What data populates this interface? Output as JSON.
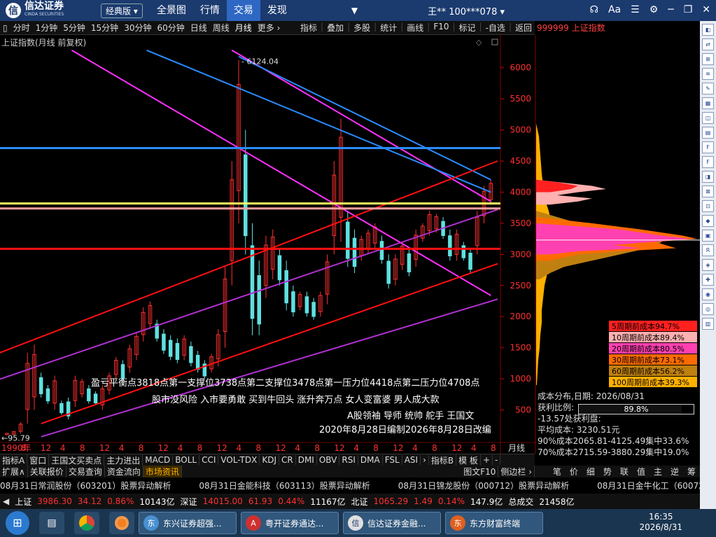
{
  "app": {
    "logo_cn": "信达证券",
    "logo_en": "CINDA SECURITIES",
    "edition": "经典版 ▾"
  },
  "nav": [
    "全景图",
    "行情",
    "交易",
    "发现"
  ],
  "nav_active": "交易",
  "user": "王**  100***078 ▾",
  "top_icons": [
    "headset-icon",
    "font-size-icon",
    "menu-icon",
    "gear-icon",
    "minimize-icon",
    "restore-icon",
    "close-icon"
  ],
  "periods": [
    "分时",
    "1分钟",
    "5分钟",
    "15分钟",
    "30分钟",
    "60分钟",
    "日线",
    "周线",
    "月线",
    "更多 ›"
  ],
  "period_selected": "月线",
  "tools": [
    "指标",
    "叠加",
    "多股",
    "统计",
    "画线",
    "F10",
    "标记",
    "-自选",
    "返回"
  ],
  "index_code": "999999 上证指数",
  "chart": {
    "title": "上证指数(月线 前复权)",
    "high_label": "6124.04",
    "low_label": "95.79",
    "y_ticks": [
      500,
      1000,
      1500,
      2000,
      2500,
      3000,
      3500,
      4000,
      4500,
      5000,
      5500,
      6000
    ],
    "x_labels": [
      "1990年",
      "8",
      "12",
      "4",
      "8",
      "12",
      "4",
      "8",
      "12",
      "4",
      "8",
      "12",
      "4",
      "8",
      "12",
      "4",
      "8",
      "12",
      "4",
      "8",
      "12",
      "4",
      "8",
      "12",
      "4",
      "8"
    ],
    "x_unit": "月线",
    "annotations": [
      "盈亏平衡点3818点第一支撑位3738点第二支撑位3478点第一压力位4418点第二压力位4708点",
      "股市没风险 入市要勇敢 买到牛回头 涨升奔万点 女人变富婆 男人成大款",
      "A股领袖 导师 统帅 舵手 王国文",
      "2020年8月28日编制2026年8月28日改编"
    ],
    "colors": {
      "up": "#ff3030",
      "down": "#60e0e0",
      "pink": "#ff30ff",
      "blue": "#2a8cff",
      "red": "#ff1010",
      "purple": "#b030d0",
      "yellow": "#ffff60",
      "salmon": "#ffa0a0"
    }
  },
  "chart_data": {
    "type": "candlestick",
    "title": "上证指数(月线 前复权)",
    "series": [
      {
        "name": "上证指数",
        "points": [
          [
            0,
            96,
            130
          ],
          [
            2,
            100,
            160
          ],
          [
            4,
            120,
            300
          ],
          [
            6,
            280,
            1420
          ],
          [
            8,
            500,
            1550
          ],
          [
            10,
            700,
            1100
          ],
          [
            12,
            600,
            900
          ],
          [
            14,
            500,
            1050
          ],
          [
            16,
            420,
            650
          ],
          [
            18,
            350,
            700
          ],
          [
            20,
            550,
            1050
          ],
          [
            22,
            700,
            1000
          ],
          [
            24,
            600,
            900
          ],
          [
            26,
            580,
            800
          ],
          [
            28,
            500,
            900
          ],
          [
            30,
            750,
            1100
          ],
          [
            32,
            1000,
            1350
          ],
          [
            34,
            950,
            1300
          ],
          [
            36,
            1100,
            1550
          ],
          [
            38,
            1300,
            1750
          ],
          [
            40,
            1600,
            2150
          ],
          [
            42,
            1800,
            2245
          ],
          [
            44,
            1600,
            1950
          ],
          [
            46,
            1400,
            1800
          ],
          [
            48,
            1300,
            1700
          ],
          [
            50,
            1250,
            1650
          ],
          [
            52,
            1300,
            1700
          ],
          [
            54,
            1200,
            1600
          ],
          [
            56,
            1100,
            1450
          ],
          [
            58,
            1000,
            1300
          ],
          [
            60,
            1100,
            1400
          ],
          [
            62,
            1200,
            1800
          ],
          [
            64,
            1500,
            2800
          ],
          [
            66,
            2500,
            4500
          ],
          [
            68,
            3500,
            6124
          ],
          [
            70,
            3000,
            5000
          ],
          [
            72,
            1700,
            3500
          ],
          [
            74,
            1700,
            2900
          ],
          [
            76,
            2300,
            3300
          ],
          [
            78,
            2600,
            3400
          ],
          [
            80,
            2500,
            3100
          ],
          [
            82,
            2100,
            2900
          ],
          [
            84,
            2000,
            2500
          ],
          [
            86,
            2100,
            2400
          ],
          [
            88,
            2000,
            2400
          ],
          [
            90,
            1950,
            2300
          ],
          [
            92,
            2000,
            2400
          ],
          [
            94,
            2200,
            3000
          ],
          [
            96,
            3000,
            4500
          ],
          [
            98,
            3200,
            5178
          ],
          [
            100,
            2800,
            3700
          ],
          [
            102,
            2700,
            3400
          ],
          [
            104,
            2900,
            3300
          ],
          [
            106,
            3000,
            3400
          ],
          [
            108,
            3100,
            3500
          ],
          [
            110,
            2850,
            3300
          ],
          [
            112,
            2450,
            3000
          ],
          [
            114,
            2500,
            3000
          ],
          [
            116,
            2750,
            3200
          ],
          [
            118,
            2650,
            3100
          ],
          [
            120,
            2800,
            3400
          ],
          [
            122,
            3200,
            3500
          ],
          [
            124,
            3300,
            3700
          ],
          [
            126,
            3350,
            3650
          ],
          [
            128,
            3250,
            3600
          ],
          [
            130,
            2900,
            3400
          ],
          [
            132,
            2900,
            3400
          ],
          [
            134,
            2900,
            3200
          ],
          [
            136,
            2700,
            3100
          ],
          [
            138,
            3000,
            3700
          ],
          [
            140,
            3500,
            4100
          ],
          [
            142,
            3800,
            4200
          ]
        ]
      }
    ],
    "axes": {
      "y_range": [
        0,
        6300
      ],
      "x_start": "1990",
      "x_end": "2026"
    },
    "horizontal_levels": [
      4708,
      3818,
      3738,
      3090
    ],
    "legend_position": "none"
  },
  "cost_table": [
    {
      "label": "5周期前成本94.7%",
      "color": "#ff2020"
    },
    {
      "label": "10周期前成本89.4%",
      "color": "#ffb0b0"
    },
    {
      "label": "20周期前成本80.5%",
      "color": "#ff40b0"
    },
    {
      "label": "30周期前成本73.1%",
      "color": "#ff6a00"
    },
    {
      "label": "60周期前成本56.2%",
      "color": "#c08010"
    },
    {
      "label": "100周期前成本39.3%",
      "color": "#ffb000"
    }
  ],
  "cost_info": {
    "date_label": "成本分布,日期:",
    "date": "2026/08/31",
    "ratio_label": "获利比例:",
    "ratio_value": "89.8%",
    "ratio_fraction": 0.898,
    "loss_line": "-13.57处获利盘:",
    "avg_cost": "平均成本:  3230.51元",
    "cost90": "90%成本2065.81-4125.49集中33.6%",
    "cost70": "70%成本2715.59-3880.29集中19.0%"
  },
  "indicator_tabs": [
    "指标A",
    "窗口",
    "王国文买卖点",
    "主力进出",
    "MACD",
    "BOLL",
    "CCI",
    "VOL-TDX",
    "KDJ",
    "CR",
    "DMI",
    "OBV",
    "RSI",
    "DMA",
    "FSL",
    "ASI",
    "›",
    "指标B",
    "模 板",
    "+",
    "-"
  ],
  "bottom_tabs": [
    "扩展∧",
    "关联报价",
    "交易查询",
    "资金流向",
    "市场资讯"
  ],
  "bottom_tab_active": "市场资讯",
  "bottom_right": [
    "图文F10",
    "侧边栏 ›"
  ],
  "right_tabs": [
    "笔",
    "价",
    "细",
    "势",
    "联",
    "值",
    "主",
    "逆",
    "筹"
  ],
  "news": [
    "08月31日常润股份（603201）股票异动解析",
    "08月31日金能科技（603113）股票异动解析",
    "08月31日锦龙股份（000712）股票异动解析",
    "08月31日金牛化工（600722）股票异动"
  ],
  "status": [
    {
      "t": "上证",
      "c": "white"
    },
    {
      "t": "3986.30",
      "c": "red"
    },
    {
      "t": "34.12",
      "c": "red"
    },
    {
      "t": "0.86%",
      "c": "red"
    },
    {
      "t": "10143亿",
      "c": "white"
    },
    {
      "t": "深证",
      "c": "white"
    },
    {
      "t": "14015.00",
      "c": "red"
    },
    {
      "t": "61.93",
      "c": "red"
    },
    {
      "t": "0.44%",
      "c": "red"
    },
    {
      "t": "11167亿",
      "c": "white"
    },
    {
      "t": "北证",
      "c": "white"
    },
    {
      "t": "1065.29",
      "c": "red"
    },
    {
      "t": "1.49",
      "c": "red"
    },
    {
      "t": "0.14%",
      "c": "red"
    },
    {
      "t": "147.9亿",
      "c": "white"
    },
    {
      "t": "总成交",
      "c": "white"
    },
    {
      "t": "21458亿",
      "c": "white"
    }
  ],
  "taskbar": {
    "apps": [
      {
        "label": "东兴证券超强...",
        "color": "#4a90d0",
        "glyph": "东"
      },
      {
        "label": "粤开证券通达...",
        "color": "#d03030",
        "glyph": "A"
      },
      {
        "label": "信达证券金融...",
        "color": "#e0e0e0",
        "glyph": "信"
      },
      {
        "label": "东方财富终端",
        "color": "#e06020",
        "glyph": "东"
      }
    ],
    "time": "16:35",
    "date": "2026/8/31"
  }
}
